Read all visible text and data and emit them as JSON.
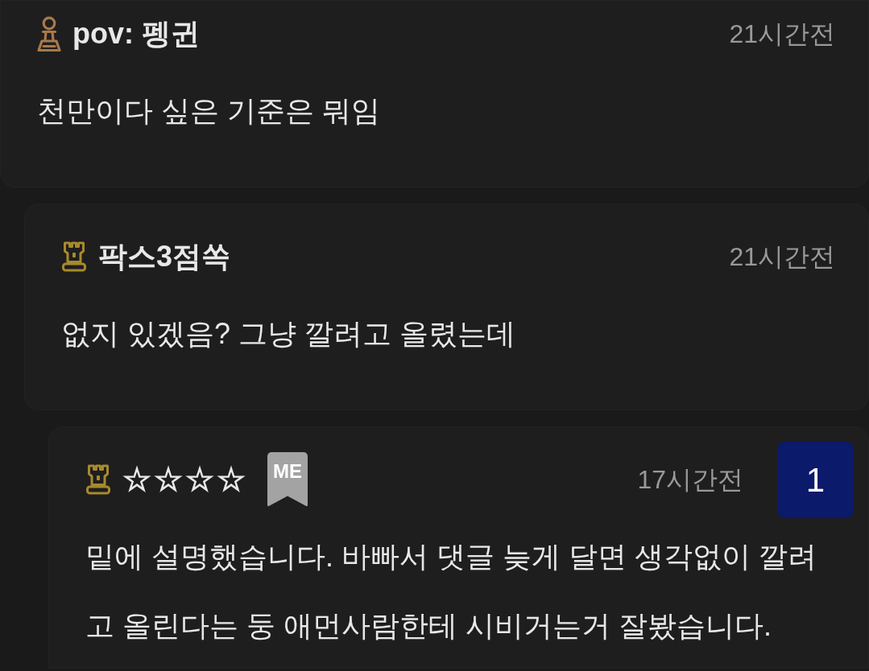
{
  "comments": [
    {
      "rank_icon": {
        "kind": "pawn",
        "color": "#a9794b"
      },
      "author": "pov: 펭귄",
      "time": "21시간전",
      "body": "천만이다 싶은 기준은 뭐임",
      "children": [
        {
          "rank_icon": {
            "kind": "rook",
            "color": "#a88a2c"
          },
          "author": "팍스3점쏙",
          "time": "21시간전",
          "body": "없지 있겠음? 그냥 깔려고 올렸는데",
          "children": [
            {
              "rank_icon": {
                "kind": "rook",
                "color": "#a88a2c"
              },
              "author": "☆☆☆☆",
              "me_tag": "ME",
              "time": "17시간전",
              "number": "1",
              "body": "밑에 설명했습니다. 바빠서 댓글 늦게 달면 생각없이 깔려고 올린다는 둥 애먼사람한테 시비거는거 잘봤습니다."
            }
          ]
        }
      ]
    }
  ]
}
